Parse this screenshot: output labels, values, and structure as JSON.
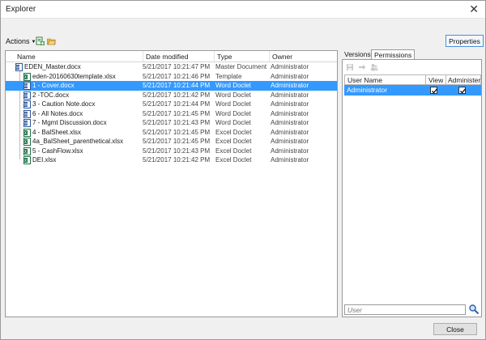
{
  "window": {
    "title": "Explorer"
  },
  "toolbar": {
    "actions_label": "Actions",
    "properties_label": "Properties"
  },
  "file_list": {
    "columns": [
      "Name",
      "Date modified",
      "Type",
      "Owner"
    ],
    "rows": [
      {
        "name": "EDEN_Master.docx",
        "date": "5/21/2017 10:21:47 PM",
        "type": "Master Document",
        "owner": "Administrator",
        "icon": "word-master-icon"
      },
      {
        "name": "eden-20160630template.xlsx",
        "date": "5/21/2017 10:21:46 PM",
        "type": "Template",
        "owner": "Administrator",
        "icon": "excel-template-icon"
      },
      {
        "name": "1 - Cover.docx",
        "date": "5/21/2017 10:21:44 PM",
        "type": "Word Doclet",
        "owner": "Administrator",
        "icon": "word-doc-icon"
      },
      {
        "name": "2 -TOC.docx",
        "date": "5/21/2017 10:21:42 PM",
        "type": "Word Doclet",
        "owner": "Administrator",
        "icon": "word-doc-icon"
      },
      {
        "name": "3 - Caution Note.docx",
        "date": "5/21/2017 10:21:44 PM",
        "type": "Word Doclet",
        "owner": "Administrator",
        "icon": "word-doc-icon"
      },
      {
        "name": "6 - All Notes.docx",
        "date": "5/21/2017 10:21:45 PM",
        "type": "Word Doclet",
        "owner": "Administrator",
        "icon": "word-doc-icon"
      },
      {
        "name": "7 - Mgmt Discussion.docx",
        "date": "5/21/2017 10:21:43 PM",
        "type": "Word Doclet",
        "owner": "Administrator",
        "icon": "word-doc-icon"
      },
      {
        "name": "4 - BalSheet.xlsx",
        "date": "5/21/2017 10:21:45 PM",
        "type": "Excel Doclet",
        "owner": "Administrator",
        "icon": "excel-doc-icon"
      },
      {
        "name": "4a_BalSheet_parenthetical.xlsx",
        "date": "5/21/2017 10:21:45 PM",
        "type": "Excel Doclet",
        "owner": "Administrator",
        "icon": "excel-doc-icon"
      },
      {
        "name": "5 - CashFlow.xlsx",
        "date": "5/21/2017 10:21:43 PM",
        "type": "Excel Doclet",
        "owner": "Administrator",
        "icon": "excel-doc-icon"
      },
      {
        "name": "DEI.xlsx",
        "date": "5/21/2017 10:21:42 PM",
        "type": "Excel Doclet",
        "owner": "Administrator",
        "icon": "excel-doc-icon"
      }
    ],
    "selected_index": 2
  },
  "right_panel": {
    "tabs": [
      "Versions",
      "Permissions"
    ],
    "active_tab": "Permissions",
    "columns": [
      "User Name",
      "View",
      "Administer"
    ],
    "users": [
      {
        "name": "Administrator",
        "view": true,
        "administer": true
      }
    ],
    "user_placeholder": "User"
  },
  "footer": {
    "close_label": "Close"
  },
  "colors": {
    "selection": "#3399ff",
    "accent_border": "#4a90d9"
  }
}
